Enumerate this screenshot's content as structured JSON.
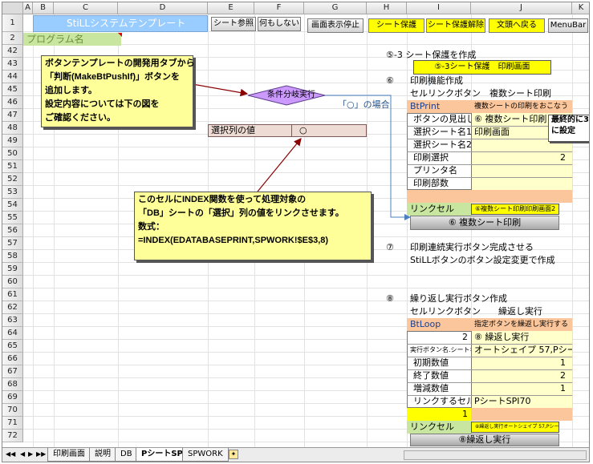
{
  "columns": [
    "A",
    "B",
    "C",
    "D",
    "E",
    "F",
    "G",
    "H",
    "I",
    "J",
    "K"
  ],
  "rows": [
    "1",
    "2",
    "42",
    "43",
    "44",
    "45",
    "46",
    "47",
    "48",
    "49",
    "50",
    "51",
    "52",
    "53",
    "54",
    "55",
    "56",
    "57",
    "58",
    "59",
    "60",
    "61",
    "62",
    "63",
    "64",
    "65",
    "66",
    "67",
    "68",
    "69",
    "70",
    "71",
    "72",
    "73"
  ],
  "header": {
    "title": "StiLLシステムテンプレート",
    "program_name": "プログラム名",
    "buttons": {
      "sheet_ref": "シート参照",
      "do_nothing": "何もしない",
      "stop_screen": "画面表示停止",
      "protect": "シート保護",
      "unprotect": "シート保護解除",
      "back_to_doc": "文頭へ戻る",
      "menubar": "MenuBar"
    }
  },
  "callouts": {
    "top": "ボタンテンプレートの開発用タブから\n「判断(MakeBtPushIf)」ボタンを\n追加します。\n設定内容については下の図を\nご確認ください。",
    "bottom": "このセルにINDEX関数を使って処理対象の\n「DB」シートの「選択」列の値をリンクさせます。\n数式：\n=INDEX(EDATABASEPRINT,SPWORK!$E$3,8)"
  },
  "flow": {
    "diamond": "条件分岐実行",
    "case_label": "「○」の場合",
    "select_label": "選択列の値",
    "select_value": "○"
  },
  "right": {
    "s53_title": "⑤-3 シート保護を作成",
    "s53_button": "⑤-3シート保護　印刷画面",
    "s6_num": "⑥",
    "s6_title": "印刷機能作成",
    "s6_sub": "セルリンクボタン　複数シート印刷",
    "btprint": "BtPrint",
    "btprint_desc": "複数シートの印刷をおこなう",
    "lbl_caption": "ボタンの見出し",
    "val_caption": "⑥ 複数シート印刷",
    "lbl_sheet1": "選択シート名1",
    "val_sheet1": "印刷画面",
    "lbl_sheet2": "選択シート名2",
    "lbl_printsel": "印刷選択",
    "val_printsel": "2",
    "lbl_printer": "プリンタ名",
    "lbl_copies": "印刷部数",
    "lbl_link": "リンクセル",
    "val_link": "⑥複数シート印刷印刷画面2",
    "btn_multi": "⑥ 複数シート印刷",
    "note": "最終的に3\nに設定",
    "s7_num": "⑦",
    "s7_title": "印刷連続実行ボタン完成させる",
    "s7_sub": "StiLLボタンのボタン設定変更で作成",
    "s8_num": "⑧",
    "s8_title": "繰り返し実行ボタン作成",
    "s8_sub": "セルリンクボタン　　繰返し実行",
    "btloop": "BtLoop",
    "btloop_desc": "指定ボタンを繰返し実行する",
    "val_loopnum": "2",
    "val_loopcap": "⑧ 繰返し実行",
    "lbl_exec": "実行ボタン名.シート名",
    "val_exec": "オートシェイプ 57,PシートSP",
    "lbl_init": "初期数値",
    "val_init": "1",
    "lbl_end": "終了数値",
    "val_end": "2",
    "lbl_inc": "増減数値",
    "val_inc": "1",
    "lbl_linkcell": "リンクするセル",
    "val_linkcell": "PシートSPI70",
    "val_70": "1",
    "lbl_link2": "リンクセル",
    "val_link2": "⑧繰返し実行オートシェイプ 57,PシートSP1 2 1 PシートSPI70",
    "btn_loop": "⑧繰返し実行"
  },
  "tabs": [
    "印刷画面",
    "説明",
    "DB",
    "PシートSP",
    "SPWORK"
  ]
}
